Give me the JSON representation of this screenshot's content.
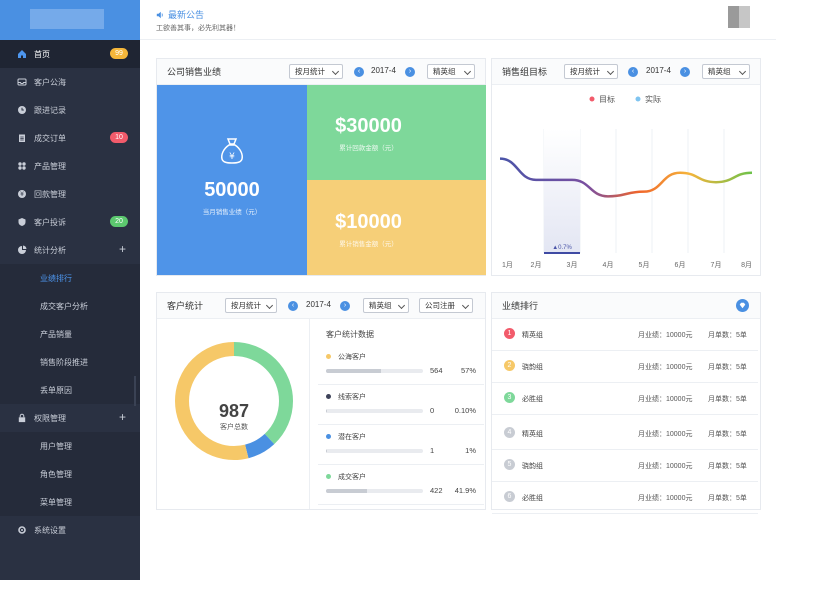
{
  "sidebar": {
    "items": [
      {
        "label": "首页",
        "icon": "home-icon",
        "badge": "99",
        "badge_color": "#f5b73b",
        "active": true
      },
      {
        "label": "客户公海",
        "icon": "inbox-icon"
      },
      {
        "label": "跟进记录",
        "icon": "clock-icon"
      },
      {
        "label": "成交订单",
        "icon": "clipboard-icon",
        "badge": "10",
        "badge_color": "#f25b6b"
      },
      {
        "label": "产品管理",
        "icon": "grid-icon"
      },
      {
        "label": "回款管理",
        "icon": "refund-icon"
      },
      {
        "label": "客户投诉",
        "icon": "shield-icon",
        "badge": "20",
        "badge_color": "#5cc86f"
      },
      {
        "label": "统计分析",
        "icon": "pie-chart-icon"
      },
      {
        "label": "权限管理",
        "icon": "lock-icon"
      },
      {
        "label": "系统设置",
        "icon": "gear-icon"
      }
    ],
    "stats_sub": [
      "业绩排行",
      "成交客户分析",
      "产品销量",
      "销售阶段推进",
      "丢单原因"
    ],
    "perm_sub": [
      "用户管理",
      "角色管理",
      "菜单管理"
    ]
  },
  "topbar": {
    "notice_title": "最新公告",
    "notice_text": "工欲善其事，必先利其器！"
  },
  "sales": {
    "title": "公司销售业绩",
    "filter": "按月统计",
    "period": "2017-4",
    "group": "精英组",
    "month_value": "50000",
    "month_label": "当月销售业绩（元）",
    "return_value": "$30000",
    "return_label": "累计回款金额（元）",
    "sales_value": "$10000",
    "sales_label": "累计销售金额（元）"
  },
  "target": {
    "title": "销售组目标",
    "filter": "按月统计",
    "period": "2017-4",
    "group": "精英组",
    "legend_target": "目标",
    "legend_actual": "实际",
    "annotation": "▲0.7%"
  },
  "chart_data": {
    "type": "line",
    "categories": [
      "1月",
      "2月",
      "3月",
      "4月",
      "5月",
      "6月",
      "7月",
      "8月"
    ],
    "series": [
      {
        "name": "目标",
        "values": []
      },
      {
        "name": "实际",
        "values": [
          80,
          62,
          62,
          48,
          52,
          68,
          60,
          68
        ]
      }
    ],
    "legend_position": "top-center",
    "grid": true
  },
  "customers": {
    "title": "客户统计",
    "filter": "按月统计",
    "period": "2017-4",
    "group": "精英组",
    "source": "公司注册",
    "total": "987",
    "total_label": "客户总数",
    "data_title": "客户统计数据",
    "rows": [
      {
        "label": "公海客户",
        "count": "564",
        "pct": "57%",
        "color": "#f6c868",
        "share": 0.57
      },
      {
        "label": "线索客户",
        "count": "0",
        "pct": "0.10%",
        "color": "#3e4359",
        "share": 0.001
      },
      {
        "label": "潜在客户",
        "count": "1",
        "pct": "1%",
        "color": "#4a90e2",
        "share": 0.01
      },
      {
        "label": "成交客户",
        "count": "422",
        "pct": "41.9%",
        "color": "#7ed89a",
        "share": 0.419
      }
    ],
    "donut": [
      {
        "color": "#7ed89a",
        "share": 0.38
      },
      {
        "color": "#4a90e2",
        "share": 0.08
      },
      {
        "color": "#f6c868",
        "share": 0.54
      }
    ]
  },
  "ranking": {
    "title": "业绩排行",
    "rows": [
      {
        "num": "1",
        "color": "#f25b6b",
        "name": "精英组",
        "amount": "月业绩：10000元",
        "orders": "月单数：5单"
      },
      {
        "num": "2",
        "color": "#f6c868",
        "name": "骁韵组",
        "amount": "月业绩：10000元",
        "orders": "月单数：5单"
      },
      {
        "num": "3",
        "color": "#7ed89a",
        "name": "必胜组",
        "amount": "月业绩：10000元",
        "orders": "月单数：5单"
      },
      {
        "num": "4",
        "color": "#c8ccd3",
        "name": "精英组",
        "amount": "月业绩：10000元",
        "orders": "月单数：5单"
      },
      {
        "num": "5",
        "color": "#c8ccd3",
        "name": "骁韵组",
        "amount": "月业绩：10000元",
        "orders": "月单数：5单"
      },
      {
        "num": "6",
        "color": "#c8ccd3",
        "name": "必胜组",
        "amount": "月业绩：10000元",
        "orders": "月单数：5单"
      }
    ]
  }
}
